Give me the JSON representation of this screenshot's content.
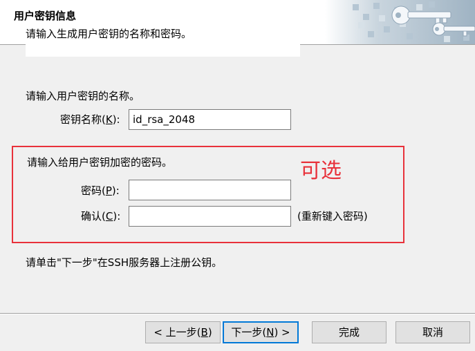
{
  "header": {
    "title": "用户密钥信息",
    "subtitle": "请输入生成用户密钥的名称和密码。"
  },
  "name_section": {
    "prompt": "请输入用户密钥的名称。",
    "key_name_label": "密钥名称(",
    "key_name_hotkey": "K",
    "key_name_label_end": "):",
    "key_name_value": "id_rsa_2048"
  },
  "password_section": {
    "prompt": "请输入给用户密钥加密的密码。",
    "password_label": "密码(",
    "password_hotkey": "P",
    "password_label_end": "):",
    "password_value": "",
    "confirm_label": "确认(",
    "confirm_hotkey": "C",
    "confirm_label_end": "):",
    "confirm_value": "",
    "confirm_hint": "(重新键入密码)"
  },
  "annotation": {
    "text": "可选",
    "color": "#e8313a"
  },
  "instruction": "请单击\"下一步\"在SSH服务器上注册公钥。",
  "buttons": {
    "back_prefix": "< 上一步(",
    "back_hotkey": "B",
    "back_suffix": ")",
    "next_prefix": "下一步(",
    "next_hotkey": "N",
    "next_suffix": ") >",
    "finish": "完成",
    "cancel": "取消"
  },
  "colors": {
    "accent": "#0078d7",
    "annotation": "#e8313a",
    "dialog_bg": "#f0f0f0"
  },
  "icons": {
    "header_art": "key-icon"
  }
}
